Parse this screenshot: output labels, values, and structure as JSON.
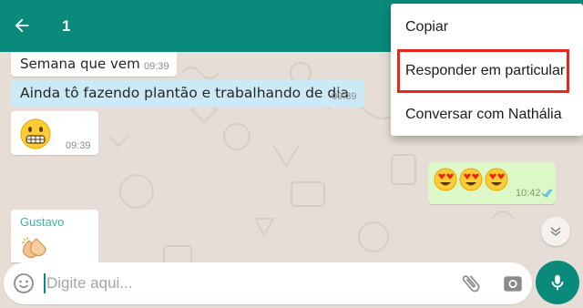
{
  "colors": {
    "accent": "#0a8a7a",
    "incoming": "#ffffff",
    "outgoing": "#dcf8c6",
    "selected": "#cce9f6",
    "sender_name": "#35b5a3",
    "highlight": "#e8261c"
  },
  "appbar": {
    "back_icon": "arrow-left-icon",
    "selected_count": "1"
  },
  "messages": [
    {
      "text": "Semana que vem",
      "time": "09:39"
    },
    {
      "text": "Ainda tô fazendo plantão e trabalhando de dia",
      "time": "09:39"
    },
    {
      "emoji": "grimacing-face",
      "time": "09:39"
    },
    {
      "emoji": "heart-eyes x3",
      "time": "10:42",
      "status": "read"
    },
    {
      "sender": "Gustavo",
      "emoji": "clapping-hands"
    }
  ],
  "context_menu": {
    "items": [
      "Copiar",
      "Responder em particular",
      "Conversar com Nathália"
    ],
    "highlighted_index": 1
  },
  "input": {
    "placeholder": "Digite aqui..."
  }
}
